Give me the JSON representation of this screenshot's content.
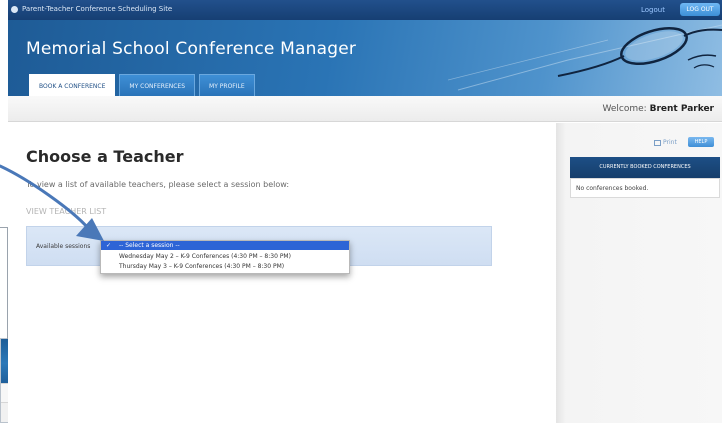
{
  "window": {
    "site_name": "Parent-Teacher Conference Scheduling Site",
    "logout_label": "Logout",
    "top_button_label": "LOG OUT"
  },
  "header": {
    "app_title": "Memorial School Conference Manager"
  },
  "tabs": [
    {
      "label": "Book a Conference",
      "active": true
    },
    {
      "label": "My Conferences",
      "active": false
    },
    {
      "label": "My Profile",
      "active": false
    }
  ],
  "welcome": {
    "prefix": "Welcome:",
    "user_name": "Brent Parker"
  },
  "main": {
    "page_title": "Choose a Teacher",
    "instructions": "To view a list of available teachers, please select a session below:",
    "list_heading": "View Teacher List",
    "session_label": "Available sessions",
    "session_options": [
      {
        "label": "-- Select a session --",
        "selected": true
      },
      {
        "label": "Wednesday May 2 – K-9 Conferences (4:30 PM – 8:30 PM)",
        "selected": false
      },
      {
        "label": "Thursday May 3 – K-9 Conferences (4:30 PM – 8:30 PM)",
        "selected": false
      }
    ]
  },
  "sidebar": {
    "print_label": "Print",
    "help_label": "HELP",
    "booked_header": "Currently Booked Conferences",
    "booked_empty": "No conferences booked."
  },
  "colors": {
    "header_blue": "#2a74b5",
    "title_bar": "#163f73",
    "selected_option": "#2d64d6",
    "annotation_arrow": "#4a78b8"
  }
}
